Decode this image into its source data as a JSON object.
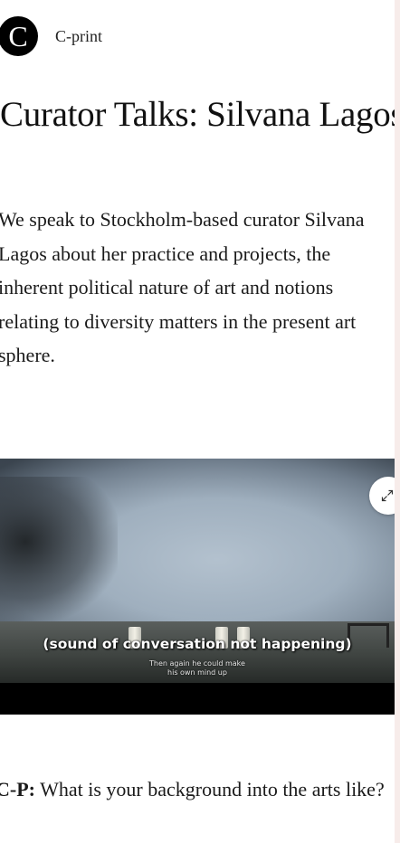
{
  "header": {
    "logo_letter": "C",
    "site_name": "C-print"
  },
  "article": {
    "title": "Curator Talks: Silvana Lagos",
    "intro": "We speak to Stockholm-based curator Silvana Lagos about her practice and projects, the inherent political nature of art and notions relating to diversity matters in the present art sphere."
  },
  "video": {
    "caption": "(sound of conversation not happening)",
    "subtitle": "Then again he could make his own mind up",
    "expand_icon": "expand-arrows-icon"
  },
  "qa": {
    "speaker": "C-P:",
    "question": "What is your background into the arts like?"
  }
}
